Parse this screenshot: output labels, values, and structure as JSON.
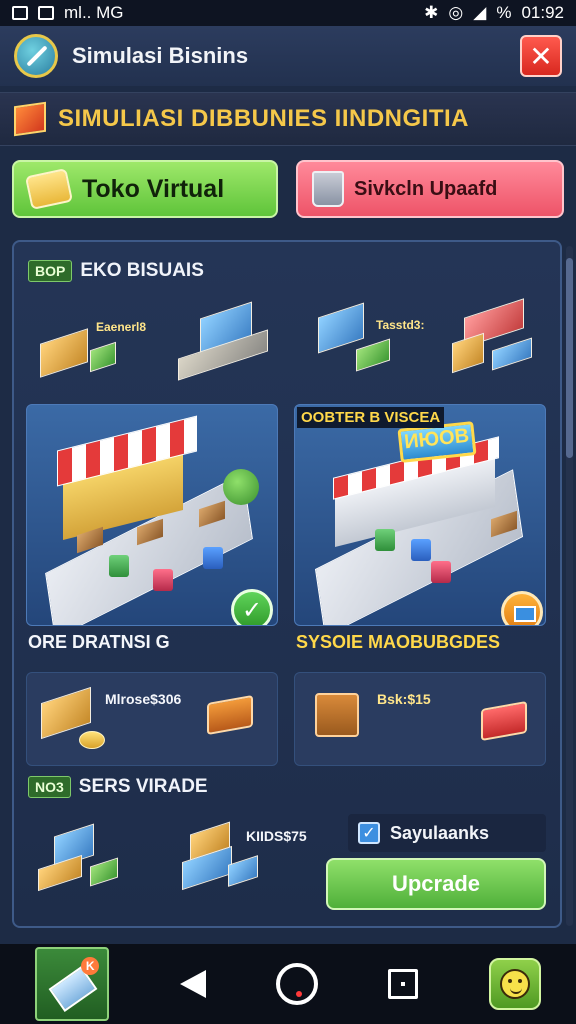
{
  "status_bar": {
    "left_text": "ml.. MG",
    "battery": "%",
    "time": "01:92"
  },
  "app": {
    "title": "Simulasi Bisnins"
  },
  "banner": {
    "text": "SIMULIASI DIBBUNIES IINDNGITIA"
  },
  "tabs": [
    {
      "label": "Toko Virtual",
      "color": "#7ed957"
    },
    {
      "label": "Sivkcln Upaafd",
      "color": "#f7707f"
    }
  ],
  "section_top": {
    "tag": "BOP",
    "title": "EKO BISUAIS",
    "mini_labels": [
      "Eaenerl8",
      "Tasstd3:"
    ]
  },
  "cards": [
    {
      "caption": "ORE DRATNSI G",
      "caption_color": "#f4f6fb",
      "badge": "✓"
    },
    {
      "top_label": "OOBTER B VISCEA",
      "sign": "ИЮОВ",
      "caption": "SYSOIE MAOBUBGDES",
      "caption_color": "#ffd84a"
    }
  ],
  "price_tiles": [
    {
      "label": "Mlrose$306"
    },
    {
      "label": "Bsk:$15"
    }
  ],
  "section_bottom": {
    "tag": "NO3",
    "title": "SERS VIRADE",
    "price_label": "KIIDS$75"
  },
  "checkbox": {
    "label": "Sayulaanks",
    "checked": true
  },
  "upgrade_button": {
    "label": "Upcrade"
  },
  "navbar": {
    "icons": [
      "home-app-icon",
      "back-icon",
      "assistant-icon",
      "recent-apps-icon",
      "smiley-app-icon"
    ]
  }
}
